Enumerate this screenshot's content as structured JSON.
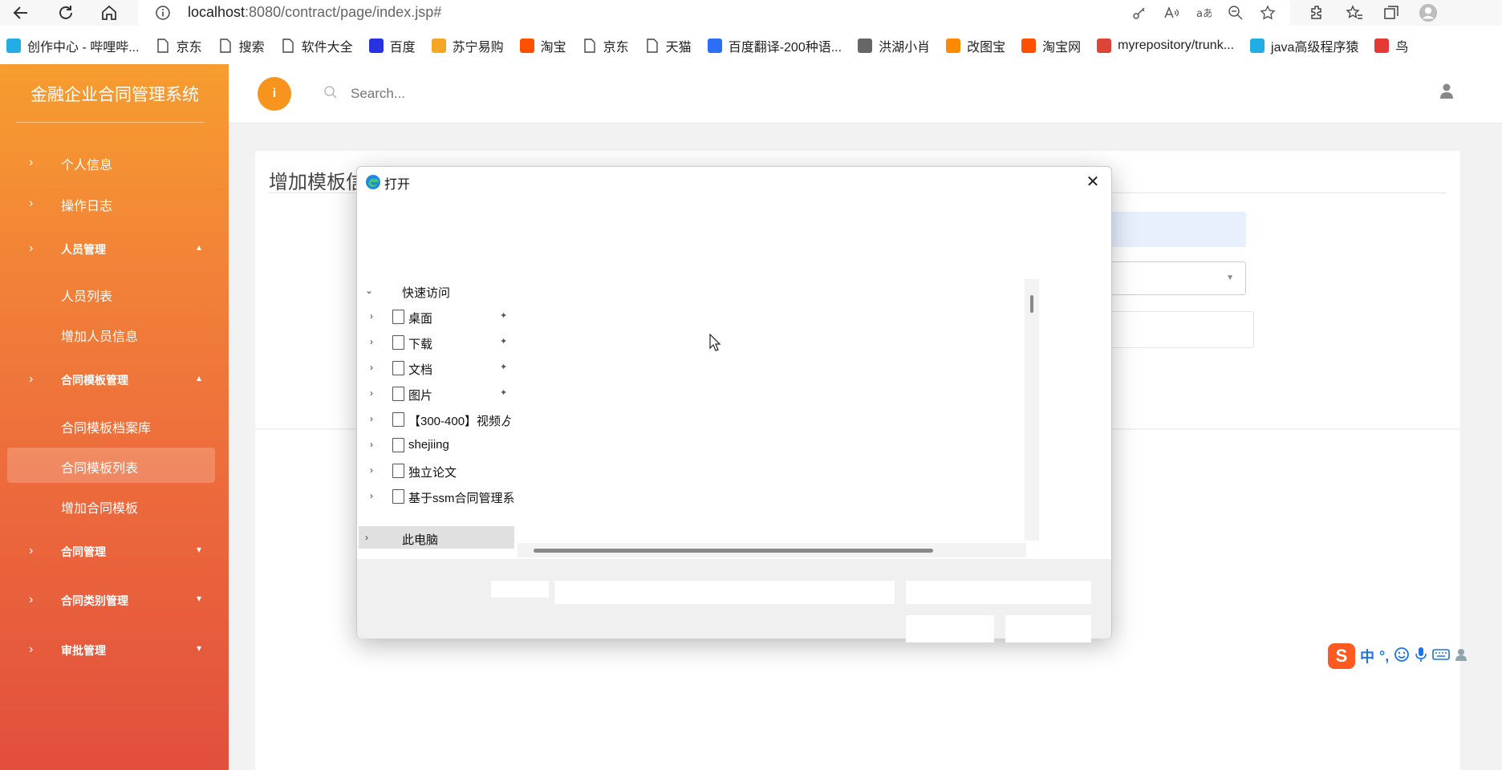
{
  "browser": {
    "url_host": "localhost",
    "url_path": ":8080/contract/page/index.jsp#",
    "bookmarks": [
      {
        "label": "创作中心 - 哔哩哔...",
        "icon": "bilibili-icon",
        "color": "#23ade5"
      },
      {
        "label": "京东",
        "icon": "page-icon",
        "color": ""
      },
      {
        "label": "搜索",
        "icon": "page-icon",
        "color": ""
      },
      {
        "label": "软件大全",
        "icon": "page-icon",
        "color": ""
      },
      {
        "label": "百度",
        "icon": "baidu-icon",
        "color": "#2932e1"
      },
      {
        "label": "苏宁易购",
        "icon": "suning-icon",
        "color": "#f5a623"
      },
      {
        "label": "淘宝",
        "icon": "taobao-icon",
        "color": "#ff5000"
      },
      {
        "label": "京东",
        "icon": "page-icon",
        "color": ""
      },
      {
        "label": "天猫",
        "icon": "page-icon",
        "color": ""
      },
      {
        "label": "百度翻译-200种语...",
        "icon": "translate-icon",
        "color": "#2a6ff4"
      },
      {
        "label": "洪湖小肖",
        "icon": "bird-icon",
        "color": "#666"
      },
      {
        "label": "改图宝",
        "icon": "gaitubao-icon",
        "color": "#ff8a00"
      },
      {
        "label": "淘宝网",
        "icon": "taobao-icon",
        "color": "#ff5000"
      },
      {
        "label": "myrepository/trunk...",
        "icon": "chrome-icon",
        "color": "#db4437"
      },
      {
        "label": "java高级程序猿",
        "icon": "bilibili-icon",
        "color": "#23ade5"
      },
      {
        "label": "鸟",
        "icon": "bird-red-icon",
        "color": "#e53935"
      }
    ]
  },
  "app": {
    "brand": "金融企业合同管理系统",
    "search_placeholder": "Search...",
    "menu": {
      "personal": "个人信息",
      "oplog": "操作日志",
      "staff": "人员管理",
      "staff_list": "人员列表",
      "staff_add": "增加人员信息",
      "tpl_mgmt": "合同模板管理",
      "tpl_archive": "合同模板档案库",
      "tpl_list": "合同模板列表",
      "tpl_add": "增加合同模板",
      "contract_mgmt": "合同管理",
      "contract_type": "合同类别管理",
      "approval": "审批管理"
    },
    "panel_title": "增加模板信"
  },
  "dialog": {
    "title": "打开",
    "tree": {
      "quick_access": "快速访问",
      "items": [
        "桌面",
        "下载",
        "文档",
        "图片",
        "【300-400】视频ゟ",
        "shejiing",
        "独立论文",
        "基于ssm合同管理系"
      ],
      "this_pc": "此电脑"
    }
  },
  "ime": {
    "lang": "中",
    "punct": "°,"
  },
  "colors": {
    "accent": "#f7941d",
    "sidebar_top": "#f79d2f",
    "sidebar_bottom": "#e24f3d"
  }
}
